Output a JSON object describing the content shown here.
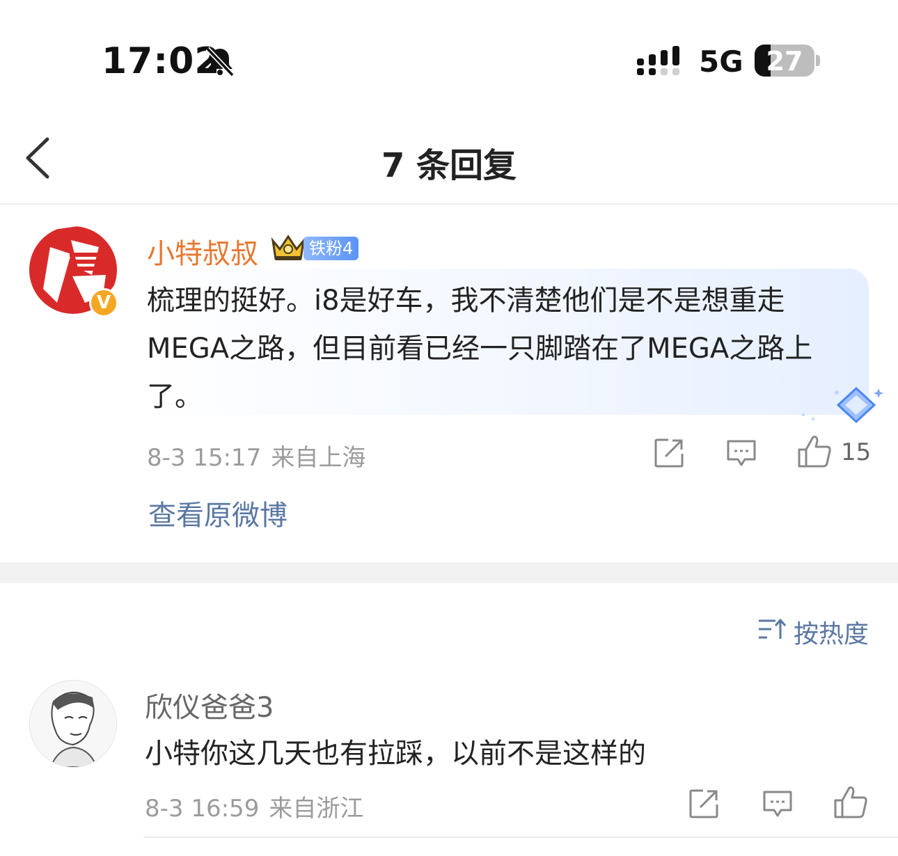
{
  "status_bar": {
    "time": "17:02",
    "network": "5G",
    "battery_percent": "27",
    "battery_level": 0.27,
    "icons": [
      "bell-muted-icon",
      "signal-icon"
    ]
  },
  "nav": {
    "back_icon": "chevron-left-icon",
    "title": "7 条回复"
  },
  "main_comment": {
    "username": "小特叔叔",
    "username_color": "#e8772e",
    "verified_badge": "V",
    "fan_badge": "铁粉4",
    "text": "梳理的挺好。i8是好车，我不清楚他们是不是想重走MEGA之路，但目前看已经一只脚踏在了MEGA之路上了。",
    "date": "8-3 15:17",
    "location": "来自上海",
    "like_count": "15",
    "view_original": "查看原微博"
  },
  "sort": {
    "label": "按热度",
    "icon": "sort-icon"
  },
  "replies": [
    {
      "username": "欣仪爸爸3",
      "text": "小特你这几天也有拉踩，以前不是这样的",
      "date": "8-3 16:59",
      "location": "来自浙江"
    }
  ],
  "colors": {
    "link_blue": "#5a77a3",
    "meta_gray": "#9b9b9b"
  }
}
